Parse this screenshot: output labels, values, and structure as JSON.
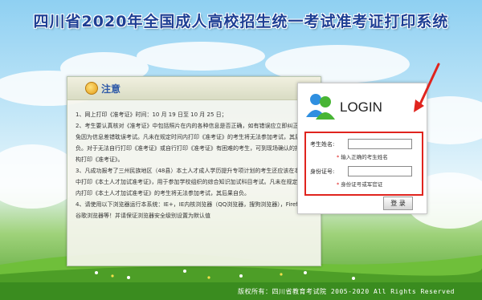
{
  "page": {
    "title": "四川省2020年全国成人高校招生统一考试准考证打印系统"
  },
  "notice": {
    "heading": "注意",
    "paragraphs": [
      "1、网上打印《准考证》时间：10 月 19 日至 10 月 25 日；",
      "2、考生要认真核对《准考证》中包括照片在内的各种信息是否正确，如有错误应立即纠正，避免因为信息差错耽误考试。凡未在规定时间内打印《准考证》的考生将无法参加考试，其后果自负。对于无法自行打印《准考证》或自行打印《准考证》有困难的考生，可到现场确认的报考机构打印《准考证》。",
      "3、凡成功报考了三州民族地区（48县）本土人才成人学历提升专项计划的考生还应该在本系统中打印《本土人才加试准考证》，用于参加学校组织的综合知识加试科目考试。凡未在规定时间内打印《本土人才加试准考证》的考生将无法参加考试，其后果自负。",
      "4、请使用以下浏览器运行本系统：IE+，IE内核浏览器（QQ浏览器，搜狗浏览器），Firefox，谷歌浏览器等！并请保证浏览器安全级别设置为默认值"
    ]
  },
  "login": {
    "title": "LOGIN",
    "name_label": "考生姓名:",
    "name_value": "",
    "name_hint": "输入正确的考生姓名",
    "id_label": "身份证号:",
    "id_value": "",
    "id_hint": "身份证号或军官证",
    "hint_star": "*",
    "submit_label": "登 录"
  },
  "footer": {
    "text": "版权所有：四川省教育考试院 2005-2020 All Rights Reserved"
  },
  "colors": {
    "title": "#1e3f94",
    "highlight": "#e0241e",
    "footer_bg": "#3a8c1f"
  }
}
